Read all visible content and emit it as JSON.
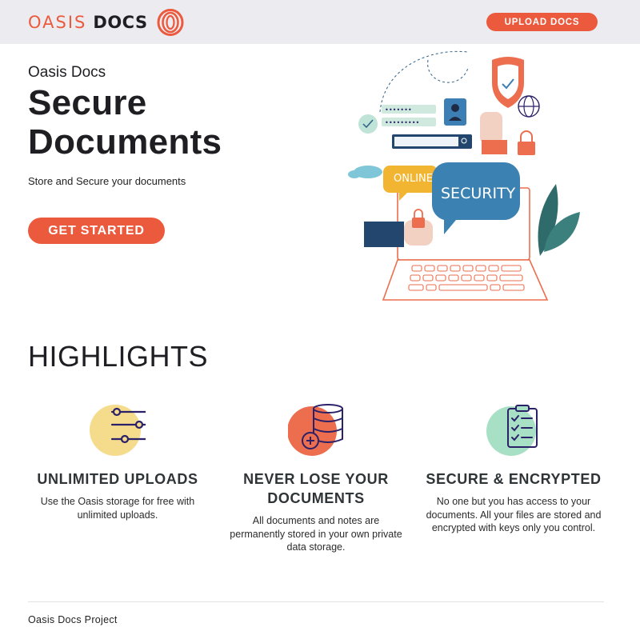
{
  "header": {
    "logo_word_1": "OASIS",
    "logo_word_2": "DOCS",
    "upload_label": "UPLOAD DOCS"
  },
  "hero": {
    "eyebrow": "Oasis Docs",
    "title_line_1": "Secure",
    "title_line_2": "Documents",
    "subtitle": "Store and Secure your documents",
    "cta_label": "GET STARTED",
    "illustration_text_1": "ONLINE",
    "illustration_text_2": "SECURITY"
  },
  "highlights": {
    "title": "HIGHLIGHTS",
    "items": [
      {
        "icon": "sliders-icon",
        "accent": "#f5dc8c",
        "title": "UNLIMITED UPLOADS",
        "description": "Use the Oasis storage for free with unlimited uploads."
      },
      {
        "icon": "database-add-icon",
        "accent": "#ec6e4f",
        "title": "NEVER LOSE YOUR DOCUMENTS",
        "description": "All documents and notes are permanently stored in your own private data storage."
      },
      {
        "icon": "checklist-icon",
        "accent": "#a8e0c6",
        "title": "SECURE & ENCRYPTED",
        "description": "No one but you has access to your documents. All your files are stored and encrypted with keys only you control."
      }
    ]
  },
  "footer": {
    "text": "Oasis Docs Project"
  },
  "colors": {
    "brand": "#ec5a3e",
    "header_bg": "#ececf0",
    "ink": "#2b2168"
  }
}
